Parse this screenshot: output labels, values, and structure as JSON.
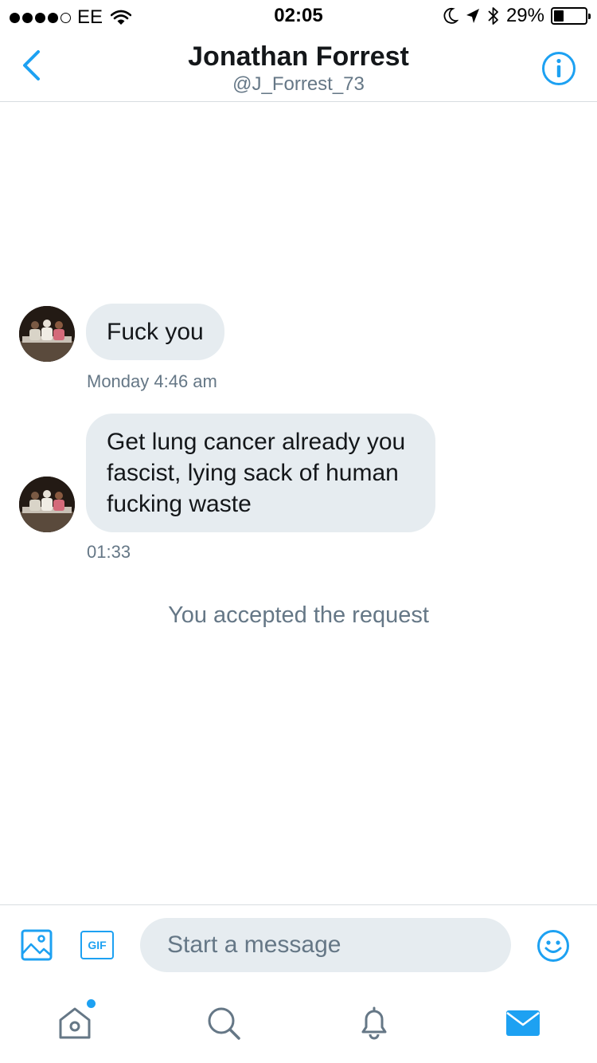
{
  "status_bar": {
    "carrier": "EE",
    "time": "02:05",
    "battery_percent": "29%",
    "battery_level": 0.29,
    "signal_bars_filled": 4,
    "icons": [
      "wifi-icon",
      "moon-icon",
      "location-arrow-icon",
      "bluetooth-icon",
      "battery-icon"
    ]
  },
  "header": {
    "title": "Jonathan Forrest",
    "handle": "@J_Forrest_73",
    "back_icon": "chevron-left-icon",
    "info_icon": "info-circle-icon"
  },
  "messages": [
    {
      "lines": [
        "Fuck you"
      ],
      "timestamp": "Monday 4:46 am"
    },
    {
      "lines": [
        "Get lung cancer already you",
        "fascist, lying sack of human",
        "fucking waste"
      ],
      "timestamp": "01:33"
    }
  ],
  "notice": "You accepted the request",
  "composer": {
    "placeholder": "Start a message",
    "gif_label": "GIF",
    "image_icon": "image-icon",
    "emoji_icon": "smiley-icon"
  },
  "tabbar": {
    "items": [
      "home-icon",
      "search-icon",
      "bell-icon",
      "mail-icon"
    ],
    "active": "mail-icon"
  },
  "colors": {
    "accent": "#1da1f2",
    "bubble": "#e6ecf0",
    "text": "#14171a",
    "muted": "#657786",
    "divider": "#d8dde1"
  }
}
